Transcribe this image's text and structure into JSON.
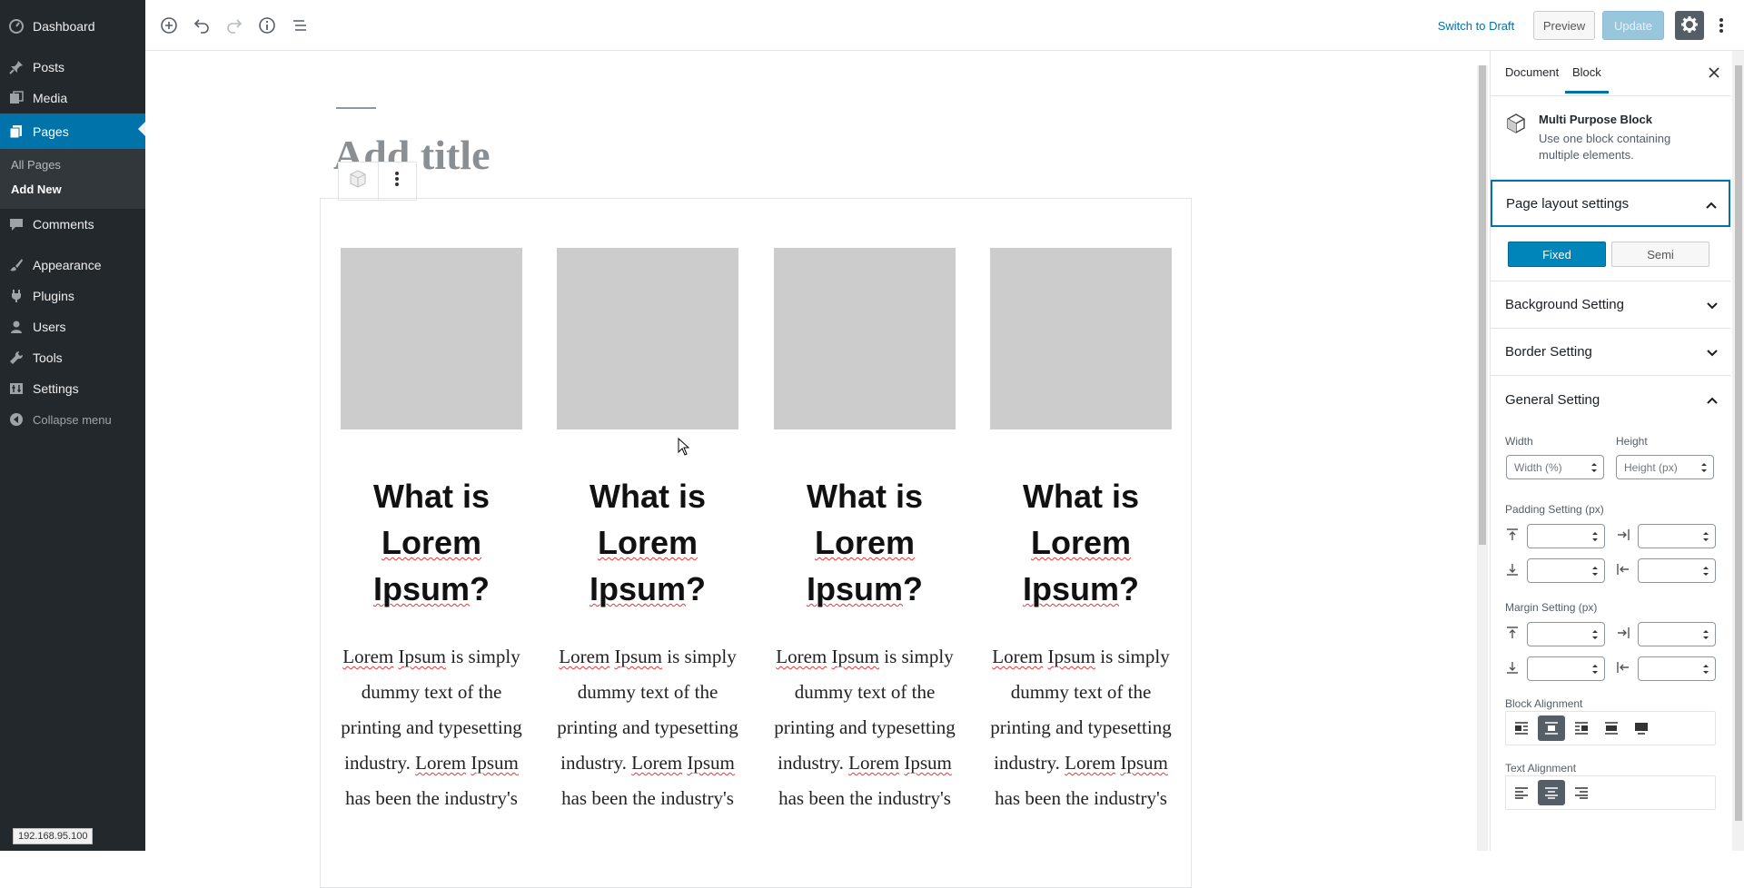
{
  "admin_menu": {
    "items": [
      {
        "label": "Dashboard",
        "icon": "dashboard-icon"
      },
      {
        "label": "Posts",
        "icon": "pin-icon"
      },
      {
        "label": "Media",
        "icon": "media-icon"
      },
      {
        "label": "Pages",
        "icon": "pages-icon"
      },
      {
        "label": "Comments",
        "icon": "comment-icon"
      },
      {
        "label": "Appearance",
        "icon": "brush-icon"
      },
      {
        "label": "Plugins",
        "icon": "plug-icon"
      },
      {
        "label": "Users",
        "icon": "user-icon"
      },
      {
        "label": "Tools",
        "icon": "wrench-icon"
      },
      {
        "label": "Settings",
        "icon": "settings-icon"
      }
    ],
    "current": "Pages",
    "submenu": [
      "All Pages",
      "Add New"
    ],
    "submenu_current": "Add New",
    "collapse_label": "Collapse menu",
    "accent": "#0073aa"
  },
  "status_url": "192.168.95.100",
  "toolbar": {
    "switch_draft": "Switch to Draft",
    "preview": "Preview",
    "update": "Update",
    "icons": [
      "add-block-icon",
      "undo-icon",
      "redo-icon",
      "info-icon",
      "outline-icon",
      "gear-icon",
      "more-vertical-icon"
    ]
  },
  "editor": {
    "title_placeholder": "Add title",
    "columns": [
      {
        "heading": "What is Lorem Ipsum?",
        "body": "Lorem Ipsum is simply dummy text of the printing and typesetting industry. Lorem Ipsum has been the industry's"
      },
      {
        "heading": "What is Lorem Ipsum?",
        "body": "Lorem Ipsum is simply dummy text of the printing and typesetting industry. Lorem Ipsum has been the industry's"
      },
      {
        "heading": "What is Lorem Ipsum?",
        "body": "Lorem Ipsum is simply dummy text of the printing and typesetting industry. Lorem Ipsum has been the industry's"
      },
      {
        "heading": "What is Lorem Ipsum?",
        "body": "Lorem Ipsum is simply dummy text of the printing and typesetting industry. Lorem Ipsum has been the industry's"
      }
    ]
  },
  "sidebar": {
    "tabs": {
      "document": "Document",
      "block": "Block"
    },
    "active_tab": "Block",
    "block_card": {
      "title": "Multi Purpose Block",
      "description": "Use one block containing multiple elements."
    },
    "sections": {
      "page_layout": "Page layout settings",
      "background": "Background Setting",
      "border": "Border Setting",
      "general": "General Setting"
    },
    "layout_buttons": {
      "fixed": "Fixed",
      "semi": "Semi"
    },
    "layout_selected": "Fixed",
    "width_label": "Width",
    "width_placeholder": "Width (%)",
    "height_label": "Height",
    "height_placeholder": "Height (px)",
    "padding_label": "Padding Setting (px)",
    "margin_label": "Margin Setting (px)",
    "block_alignment_label": "Block Alignment",
    "block_alignment_selected": "center",
    "text_alignment_label": "Text Alignment",
    "text_alignment_selected": "center"
  }
}
